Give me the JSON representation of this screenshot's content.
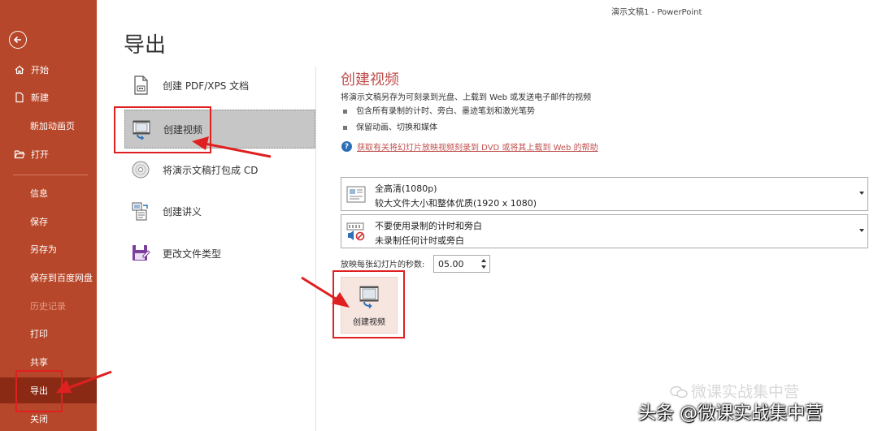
{
  "window": {
    "title": "演示文稿1  -  PowerPoint"
  },
  "sidebar": {
    "items": [
      {
        "label": "开始",
        "icon": "home-icon"
      },
      {
        "label": "新建",
        "icon": "new-file-icon"
      },
      {
        "label": "新加动画页"
      },
      {
        "label": "打开",
        "icon": "folder-open-icon"
      },
      {
        "label": "信息"
      },
      {
        "label": "保存"
      },
      {
        "label": "另存为"
      },
      {
        "label": "保存到百度网盘"
      },
      {
        "label": "历史记录",
        "disabled": true
      },
      {
        "label": "打印"
      },
      {
        "label": "共享"
      },
      {
        "label": "导出",
        "selected": true
      },
      {
        "label": "关闭"
      }
    ]
  },
  "page_title": "导出",
  "export_options": [
    {
      "label": "创建 PDF/XPS 文档",
      "icon": "pdf-document-icon"
    },
    {
      "label": "创建视频",
      "icon": "video-icon",
      "selected": true
    },
    {
      "label": "将演示文稿打包成 CD",
      "icon": "cd-icon"
    },
    {
      "label": "创建讲义",
      "icon": "handout-icon"
    },
    {
      "label": "更改文件类型",
      "icon": "save-file-type-icon"
    }
  ],
  "panel": {
    "title": "创建视频",
    "description": "将演示文稿另存为可刻录到光盘、上载到 Web 或发送电子邮件的视频",
    "bullets": [
      "包含所有录制的计时、旁白、墨迹笔划和激光笔势",
      "保留动画、切换和媒体"
    ],
    "help_link": "获取有关将幻灯片放映视频刻录到 DVD 或将其上载到 Web 的帮助",
    "quality": {
      "line1": "全高清(1080p)",
      "line2": "较大文件大小和整体优质(1920 x 1080)"
    },
    "timing": {
      "line1": "不要使用录制的计时和旁白",
      "line2": "未录制任何计时或旁白"
    },
    "seconds_label": "放映每张幻灯片的秒数:",
    "seconds_value": "05.00",
    "create_button_label": "创建视频"
  },
  "watermarks": {
    "line1": "微课实战集中营",
    "line2": "头条 @微课实战集中营"
  },
  "colors": {
    "sidebar": "#b7472a",
    "sidebar_selected": "#8b2a14",
    "accent": "#c0504d",
    "annotation": "#e02020"
  }
}
